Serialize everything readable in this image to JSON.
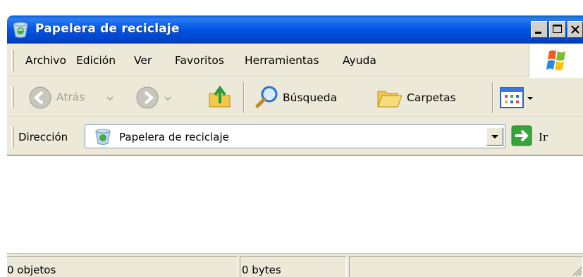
{
  "window": {
    "title": "Papelera de reciclaje"
  },
  "title_buttons": {
    "minimize": "_",
    "maximize": "□",
    "close": "×"
  },
  "menu": {
    "items": [
      "Archivo",
      "Edición",
      "Ver",
      "Favoritos",
      "Herramientas",
      "Ayuda"
    ]
  },
  "toolbar": {
    "back_label": "Atrás",
    "search_label": "Búsqueda",
    "folders_label": "Carpetas"
  },
  "address": {
    "label": "Dirección",
    "value": "Papelera de reciclaje",
    "go_label": "Ir"
  },
  "status": {
    "objects": "0 objetos",
    "size": "0 bytes"
  },
  "colors": {
    "titlebar": "#0055e5",
    "chrome": "#ece9d8",
    "go_green": "#3aa33a",
    "folder_yellow": "#f4c84a"
  }
}
